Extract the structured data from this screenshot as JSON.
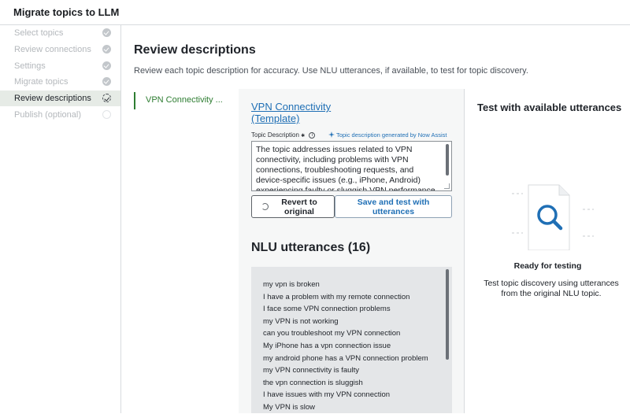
{
  "app": {
    "title": "Migrate topics to LLM"
  },
  "sidebar": {
    "steps": [
      {
        "label": "Select topics",
        "status": "done"
      },
      {
        "label": "Review connections",
        "status": "done"
      },
      {
        "label": "Settings",
        "status": "done"
      },
      {
        "label": "Migrate topics",
        "status": "done"
      },
      {
        "label": "Review descriptions",
        "status": "current"
      },
      {
        "label": "Publish (optional)",
        "status": "pending"
      }
    ]
  },
  "main": {
    "title": "Review descriptions",
    "subtitle": "Review each topic description for accuracy. Use NLU utterances, if available, to test for topic discovery."
  },
  "topic_list": {
    "selected": "VPN Connectivity ..."
  },
  "editor": {
    "topic_name": "VPN Connectivity",
    "topic_suffix": "(Template)",
    "desc_label": "Topic Description",
    "required_marker": "✱",
    "generated_note": "Topic description generated by Now Assist",
    "description": "The topic addresses issues related to VPN connectivity, including problems with VPN connections, troubleshooting requests, and device-specific issues (e.g., iPhone, Android) experiencing faulty or sluggish VPN performance.",
    "revert_label": "Revert to original",
    "save_label": "Save and test with utterances"
  },
  "nlu": {
    "title": "NLU utterances (16)",
    "utterances": [
      "my vpn is broken",
      "I have a problem with my remote connection",
      "I face some VPN connection problems",
      "my VPN is not working",
      "can you troubleshoot my VPN connection",
      "My iPhone has a vpn connection issue",
      "my android phone has a VPN connection problem",
      "my VPN connectivity is faulty",
      "the vpn connection is sluggish",
      "I have issues with my VPN connection",
      "My VPN is slow"
    ]
  },
  "test": {
    "title": "Test with available utterances",
    "ready": "Ready for testing",
    "ready_sub": "Test topic discovery using utterances from the original NLU topic."
  },
  "colors": {
    "accent": "#1f6fb5",
    "active_green": "#2e7d32",
    "active_bg": "#e6ebe6"
  },
  "icons": {
    "step_done": "check-circle-icon",
    "step_current": "progress-circle-icon",
    "step_pending": "empty-circle-icon",
    "info": "info-icon",
    "sparkle": "sparkle-icon",
    "undo": "undo-icon",
    "search_document": "search-document-icon"
  }
}
